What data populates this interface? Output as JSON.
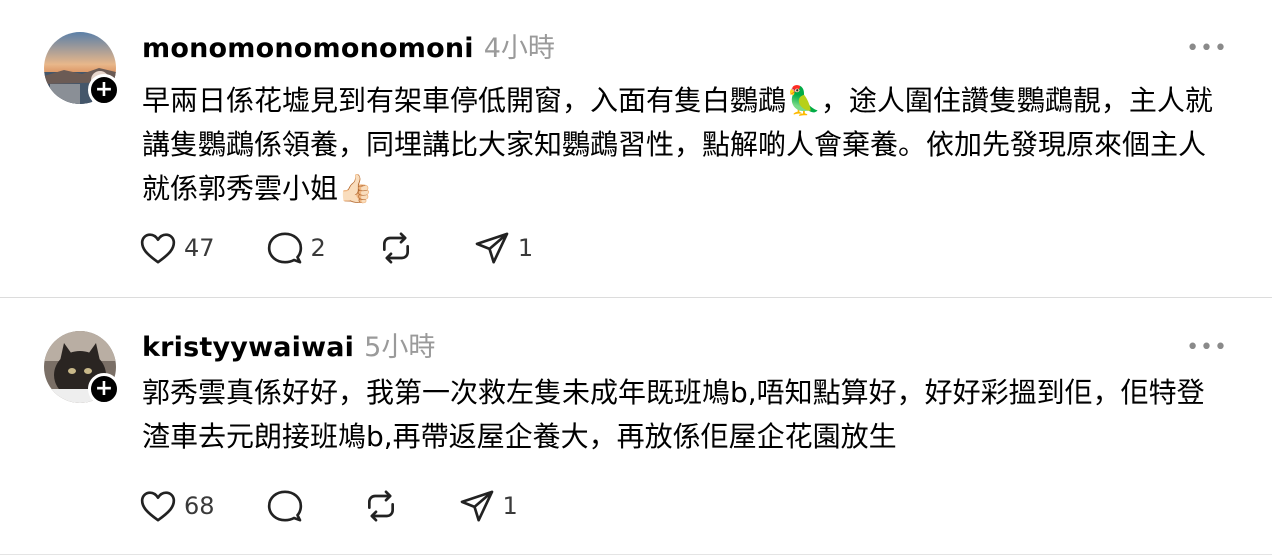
{
  "posts": [
    {
      "username": "monomonomonomoni",
      "time": "4小時",
      "text_main": "早兩日係花墟見到有架車停低開窗，入面有隻白鸚鵡🦜，途人圍住讚隻鸚鵡靚，主人就講隻鸚鵡係領養，同埋講比大家知鸚鵡習性，點解啲人會棄養。依加先發現原來個主人就係郭秀雲小姐👍🏻",
      "likes": "47",
      "comments": "2",
      "reposts": "",
      "shares": "1",
      "more_label": "•••",
      "follow_label": "+",
      "avatar_icon": "sunset-landscape-avatar"
    },
    {
      "username": "kristyywaiwai",
      "time": "5小時",
      "text_main": "郭秀雲真係好好，我第一次救左隻未成年既班鳩b,唔知點算好，好好彩搵到佢，佢特登渣車去元朗接班鳩b,再帶返屋企養大，再放係佢屋企花園放生",
      "likes": "68",
      "comments": "",
      "reposts": "",
      "shares": "1",
      "more_label": "•••",
      "follow_label": "+",
      "avatar_icon": "cat-avatar"
    }
  ],
  "colors": {
    "text": "#000000",
    "muted": "#9a9a9a",
    "divider": "#dcdcdc",
    "badge": "#000000"
  }
}
